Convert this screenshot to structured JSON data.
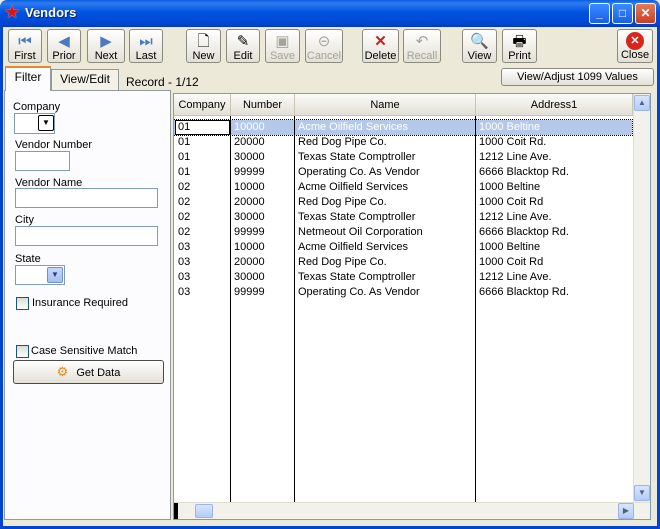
{
  "window": {
    "title": "Vendors"
  },
  "toolbar": {
    "buttons": [
      {
        "label": "First",
        "icon": "first-icon"
      },
      {
        "label": "Prior",
        "icon": "prior-icon"
      },
      {
        "label": "Next",
        "icon": "next-icon"
      },
      {
        "label": "Last",
        "icon": "last-icon"
      },
      {
        "label": "New",
        "icon": "new-icon"
      },
      {
        "label": "Edit",
        "icon": "edit-icon"
      },
      {
        "label": "Save",
        "icon": "save-icon",
        "disabled": true
      },
      {
        "label": "Cancel",
        "icon": "cancel-icon",
        "disabled": true
      },
      {
        "label": "Delete",
        "icon": "delete-icon"
      },
      {
        "label": "Recall",
        "icon": "recall-icon",
        "disabled": true
      },
      {
        "label": "View",
        "icon": "view-icon"
      },
      {
        "label": "Print",
        "icon": "print-icon"
      },
      {
        "label": "Close",
        "icon": "close-icon"
      }
    ],
    "adjust_1099_label": "View/Adjust 1099 Values"
  },
  "tabs": [
    {
      "label": "Filter",
      "active": true
    },
    {
      "label": "View/Edit",
      "active": false
    }
  ],
  "record_status": "Record - 1/12",
  "filter": {
    "company_label": "Company",
    "vendor_number_label": "Vendor Number",
    "vendor_name_label": "Vendor Name",
    "city_label": "City",
    "state_label": "State",
    "insurance_label": "Insurance Required",
    "case_sensitive_label": "Case Sensitive Match",
    "get_data_label": "Get Data"
  },
  "grid": {
    "columns": [
      "Company",
      "Number",
      "Name",
      "Address1"
    ],
    "rows": [
      [
        "01",
        "10000",
        "Acme Oilfield Services",
        "1000 Beltine"
      ],
      [
        "01",
        "20000",
        "Red Dog Pipe Co.",
        "1000 Coit Rd."
      ],
      [
        "01",
        "30000",
        "Texas State Comptroller",
        "1212 Line Ave."
      ],
      [
        "01",
        "99999",
        "Operating Co. As Vendor",
        "6666 Blacktop Rd."
      ],
      [
        "02",
        "10000",
        "Acme Oilfield Services",
        "1000 Beltine"
      ],
      [
        "02",
        "20000",
        "Red Dog Pipe Co.",
        "1000 Coit Rd"
      ],
      [
        "02",
        "30000",
        "Texas State Comptroller",
        "1212 Line Ave."
      ],
      [
        "02",
        "99999",
        "Netmeout Oil Corporation",
        "6666 Blacktop Rd."
      ],
      [
        "03",
        "10000",
        "Acme Oilfield Services",
        "1000 Beltine"
      ],
      [
        "03",
        "20000",
        "Red Dog Pipe Co.",
        "1000 Coit Rd"
      ],
      [
        "03",
        "30000",
        "Texas State Comptroller",
        "1212 Line Ave."
      ],
      [
        "03",
        "99999",
        "Operating Co. As Vendor",
        "6666 Blacktop Rd."
      ]
    ],
    "selected_row": 0
  },
  "colors": {
    "title_bar": "#0053e0",
    "selection": "#b4c8ea",
    "tab_accent": "#e68b2c"
  }
}
